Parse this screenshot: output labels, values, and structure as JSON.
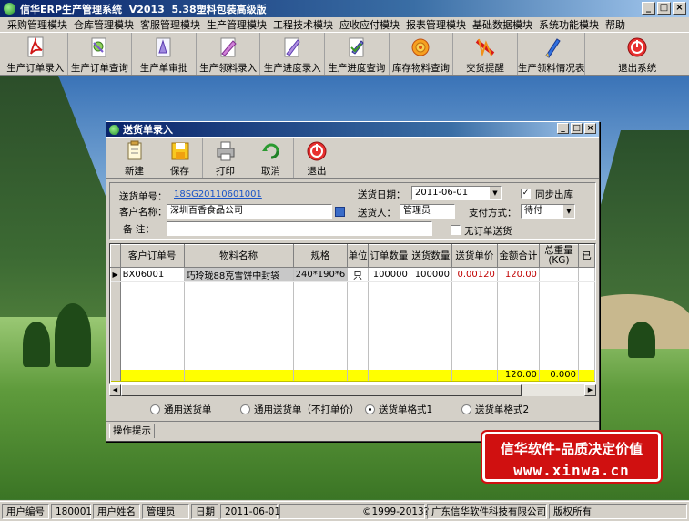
{
  "app": {
    "title": "信华ERP生产管理系统  V2013  5.38塑料包装高级版",
    "min_glyph": "_",
    "max_glyph": "□",
    "close_glyph": "×"
  },
  "menu": [
    "采购管理模块",
    "仓库管理模块",
    "客服管理模块",
    "生产管理模块",
    "工程技术模块",
    "应收应付模块",
    "报表管理模块",
    "基础数据模块",
    "系统功能模块",
    "帮助"
  ],
  "toolbar": [
    {
      "label": "生产订单录入",
      "icon": "pdf-document-icon"
    },
    {
      "label": "生产订单查询",
      "icon": "search-document-icon"
    },
    {
      "label": "生产单审批",
      "icon": "approval-icon"
    },
    {
      "label": "生产领料录入",
      "icon": "material-entry-icon"
    },
    {
      "label": "生产进度录入",
      "icon": "progress-entry-icon"
    },
    {
      "label": "生产进度查询",
      "icon": "progress-query-icon"
    },
    {
      "label": "库存物料查询",
      "icon": "inventory-icon"
    },
    {
      "label": "交货提醒",
      "icon": "delivery-reminder-icon"
    },
    {
      "label": "生产领料情况表",
      "icon": "report-pen-icon"
    },
    {
      "label": "退出系统",
      "icon": "exit-icon"
    }
  ],
  "dialog": {
    "title": "送货单录入",
    "toolbar": [
      {
        "label": "新建",
        "icon": "new-icon"
      },
      {
        "label": "保存",
        "icon": "save-icon"
      },
      {
        "label": "打印",
        "icon": "print-icon"
      },
      {
        "label": "取消",
        "icon": "cancel-icon"
      },
      {
        "label": "退出",
        "icon": "exit-icon"
      }
    ],
    "form": {
      "delivery_no_label": "送货单号：",
      "delivery_no_value": "18SG20110601001",
      "delivery_date_label": "送货日期：",
      "delivery_date_value": "2011-06-01",
      "sync_out_label": "同步出库",
      "sync_out_checked": true,
      "customer_label": "客户名称：",
      "customer_value": "深圳百香食品公司",
      "deliverer_label": "送货人：",
      "deliverer_value": "管理员",
      "payment_label": "支付方式：",
      "payment_value": "待付",
      "remark_label": "备  注：",
      "remark_value": "",
      "no_order_label": "无订单送货",
      "no_order_checked": false
    },
    "grid": {
      "columns": [
        "客户订单号",
        "物料名称",
        "规格",
        "单位",
        "订单数量",
        "送货数量",
        "送货单价",
        "金额合计",
        "总重量(KG)",
        "已"
      ],
      "rows": [
        {
          "order_no": "BX06001",
          "material": "巧玲珑88克雪饼中封袋",
          "spec": "240*190*6",
          "unit": "只",
          "order_qty": "100000",
          "delivery_qty": "100000",
          "unit_price": "0.00120",
          "amount": "120.00",
          "weight": ""
        }
      ],
      "totals": {
        "amount": "120.00",
        "weight": "0.000"
      }
    },
    "print_formats": [
      {
        "label": "通用送货单",
        "selected": false
      },
      {
        "label": "通用送货单（不打单价）",
        "selected": false
      },
      {
        "label": "送货单格式1",
        "selected": true
      },
      {
        "label": "送货单格式2",
        "selected": false
      }
    ],
    "tip_tab": "操作提示"
  },
  "promo": {
    "line1": "信华软件-品质决定价值",
    "line2": "www.xinwa.cn"
  },
  "status": {
    "user_no_label": "用户编号",
    "user_no_value": "180001",
    "user_name_label": "用户姓名",
    "user_name_value": "管理员",
    "date_label": "日期",
    "date_value": "2011-06-01",
    "copyright": "©1999-2013?",
    "company": "广东信华软件科技有限公司",
    "rights": "版权所有"
  }
}
